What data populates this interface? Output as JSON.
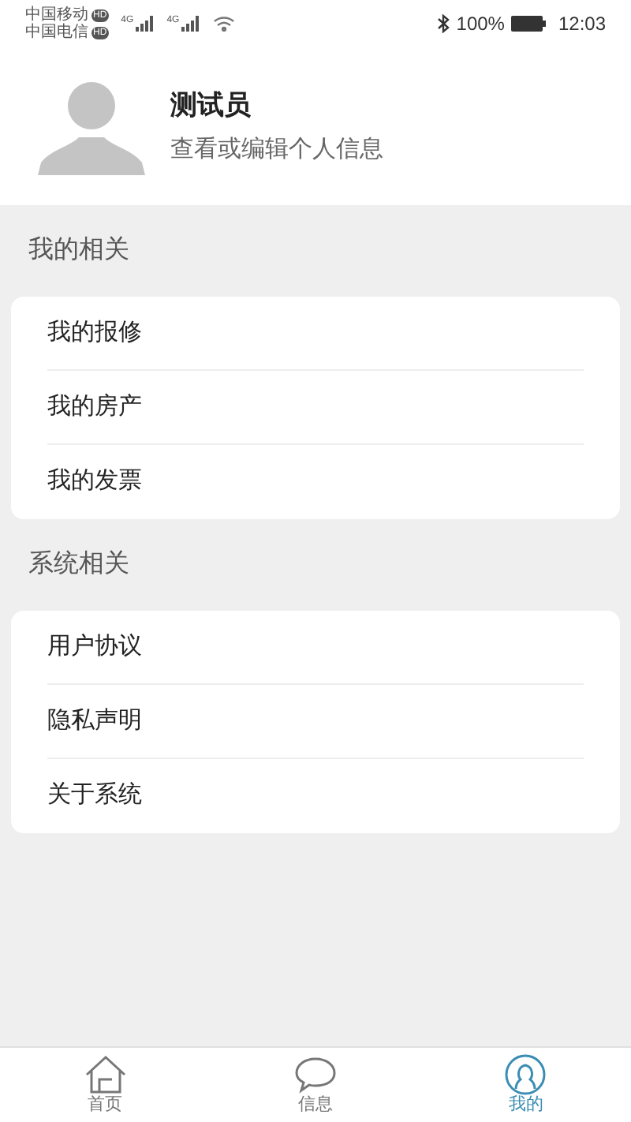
{
  "status_bar": {
    "carriers": [
      {
        "name": "中国移动",
        "badge": "HD",
        "network": "4G"
      },
      {
        "name": "中国电信",
        "badge": "HD",
        "network": "4G"
      }
    ],
    "battery": "100%",
    "time": "12:03"
  },
  "profile": {
    "name": "测试员",
    "subtitle": "查看或编辑个人信息"
  },
  "sections": [
    {
      "title": "我的相关",
      "items": [
        "我的报修",
        "我的房产",
        "我的发票"
      ]
    },
    {
      "title": "系统相关",
      "items": [
        "用户协议",
        "隐私声明",
        "关于系统"
      ]
    }
  ],
  "tab_bar": [
    {
      "label": "首页",
      "kind": "home",
      "selected": false
    },
    {
      "label": "信息",
      "kind": "chat",
      "selected": false
    },
    {
      "label": "我的",
      "kind": "profile",
      "selected": true
    }
  ]
}
